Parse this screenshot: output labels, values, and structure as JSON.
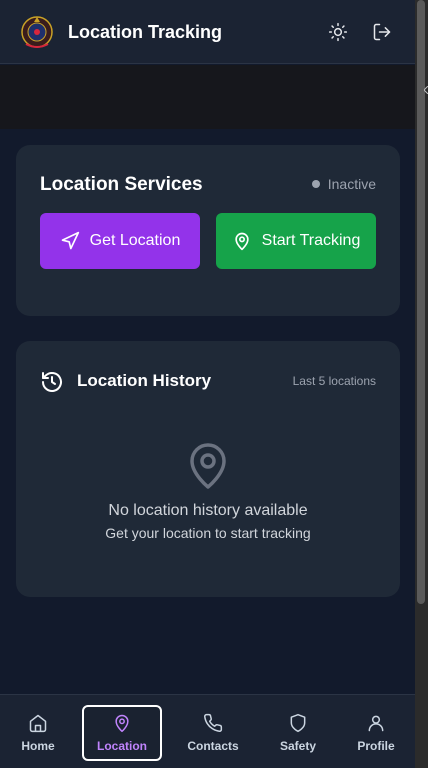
{
  "header": {
    "title": "Location Tracking",
    "logo_icon": "police-emblem-icon",
    "theme_icon": "sun-icon",
    "logout_icon": "logout-icon"
  },
  "services": {
    "title": "Location Services",
    "status": "Inactive",
    "get_location_label": "Get Location",
    "start_tracking_label": "Start Tracking"
  },
  "history": {
    "title": "Location History",
    "subtitle": "Last 5 locations",
    "empty_title": "No location history available",
    "empty_subtitle": "Get your location to start tracking"
  },
  "nav": {
    "items": [
      {
        "label": "Home",
        "icon": "home-icon"
      },
      {
        "label": "Location",
        "icon": "map-pin-icon",
        "active": true
      },
      {
        "label": "Contacts",
        "icon": "phone-icon"
      },
      {
        "label": "Safety",
        "icon": "shield-icon"
      },
      {
        "label": "Profile",
        "icon": "user-icon"
      }
    ]
  },
  "colors": {
    "primary": "#9333ea",
    "success": "#16a34a",
    "active_nav": "#c084fc",
    "card": "#1f2937",
    "background": "#121a2c"
  }
}
